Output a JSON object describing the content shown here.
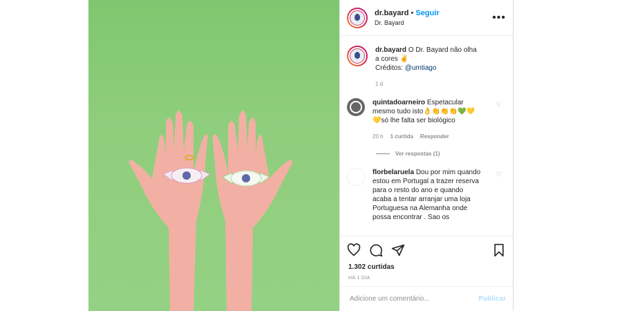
{
  "colors": {
    "accent": "#0095f6",
    "photo_bg": "#8fce7c",
    "muted": "#8e8e8e",
    "emoji_yellow": "#f3d32b",
    "emoji_green": "#39c043"
  },
  "header": {
    "username": "dr.bayard",
    "dot": "•",
    "follow": "Seguir",
    "subtitle": "Dr. Bayard",
    "more": "•••"
  },
  "caption": {
    "username": "dr.bayard",
    "text": "O Dr. Bayard não olha a cores ✌",
    "credits_label": "Créditos:",
    "credits_link": "@umtiago",
    "time": "1 d"
  },
  "comments": [
    {
      "username": "quintadoarneiro",
      "text": "Espetacular mesmo tudo isto👌👏👏👏💚💛💛só lhe falta ser biológico",
      "time": "20 h",
      "likes": "1 curtida",
      "reply": "Responder",
      "view_replies": "Ver respostas (1)"
    },
    {
      "username": "florbelaruela",
      "text": "Dou por mim quando estou em Portugal a trazer reserva para o resto do ano e quando acaba a tentar arranjar uma loja Portuguesa na Alemanha onde possa encontrar . Sao os"
    }
  ],
  "actions": {
    "like_icon": "heart-icon",
    "comment_icon": "comment-icon",
    "share_icon": "paper-plane-icon",
    "save_icon": "bookmark-icon"
  },
  "likes": "1.302 curtidas",
  "date": "HÁ 1 DIA",
  "add_comment": {
    "placeholder": "Adicione um comentário...",
    "publish": "Publicar"
  }
}
